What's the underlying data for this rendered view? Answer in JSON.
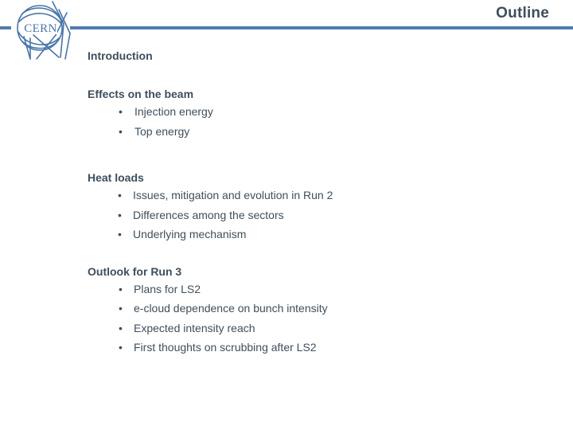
{
  "slide": {
    "title": "Outline",
    "logo": {
      "name": "cern-logo",
      "wordmark": "CERN",
      "color": "#4a74a8"
    },
    "accent_color": "#4f7cab",
    "text_color": "#3f4e5c",
    "background_color": "#ffffff"
  },
  "outline": {
    "sections": [
      {
        "heading": "Introduction",
        "bullets": []
      },
      {
        "heading": "Effects on the beam",
        "bullets": [
          "Injection energy",
          "Top energy"
        ]
      },
      {
        "heading": "Heat loads",
        "bullets": [
          "Issues, mitigation and evolution in Run 2",
          "Differences among the sectors",
          "Underlying mechanism"
        ]
      },
      {
        "heading": "Outlook for Run 3",
        "bullets": [
          "Plans for LS2",
          "e-cloud dependence on bunch intensity",
          "Expected intensity reach",
          "First thoughts on scrubbing after LS2"
        ]
      }
    ],
    "bullet_glyph": "•"
  }
}
